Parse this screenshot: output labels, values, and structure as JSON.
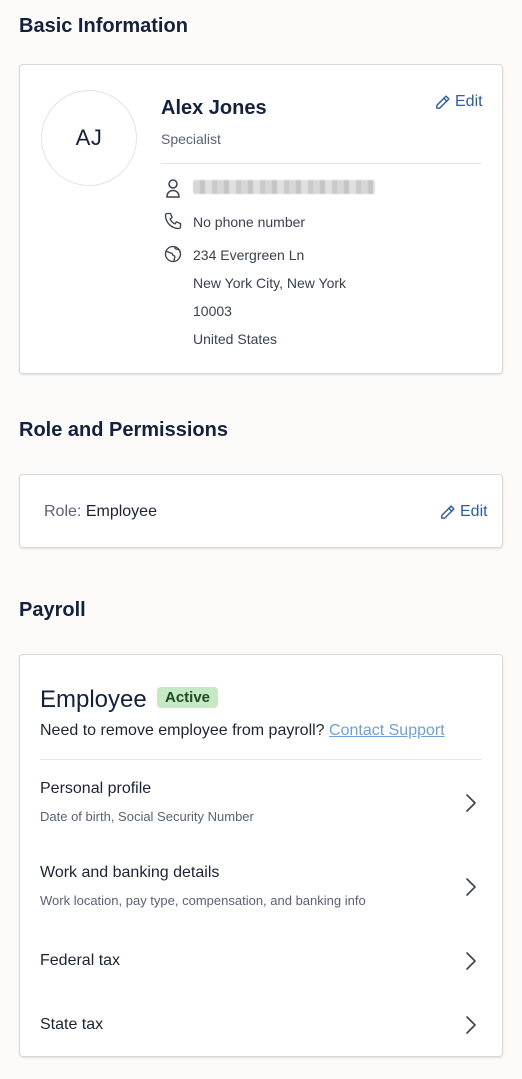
{
  "basic_info": {
    "heading": "Basic Information",
    "initials": "AJ",
    "name": "Alex Jones",
    "job_title": "Specialist",
    "edit_label": "Edit",
    "phone": "No phone number",
    "address": {
      "line1": "234 Evergreen Ln",
      "line2": "New York City, New York",
      "zip": "10003",
      "country": "United States"
    }
  },
  "role": {
    "heading": "Role and Permissions",
    "label": "Role:",
    "value": "Employee",
    "edit_label": "Edit"
  },
  "payroll": {
    "heading": "Payroll",
    "employee_heading": "Employee",
    "status_badge": "Active",
    "remove_text": "Need to remove employee from payroll?",
    "contact_link": "Contact Support",
    "items": [
      {
        "title": "Personal profile",
        "subtitle": "Date of birth, Social Security Number"
      },
      {
        "title": "Work and banking details",
        "subtitle": "Work location, pay type, compensation, and banking info"
      },
      {
        "title": "Federal tax",
        "subtitle": ""
      },
      {
        "title": "State tax",
        "subtitle": ""
      }
    ]
  },
  "colors": {
    "accent": "#2e5c9e",
    "link": "#6f9fd6",
    "badge_bg": "#c7e8c5",
    "heading": "#14213d"
  }
}
